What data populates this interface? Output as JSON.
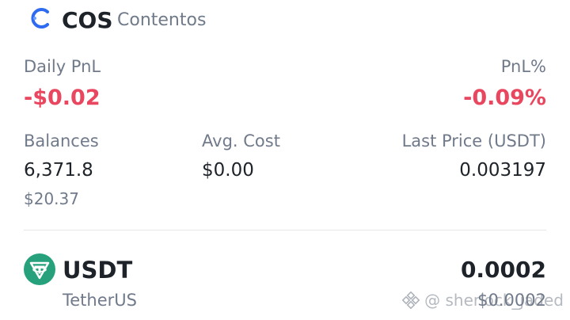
{
  "header": {
    "symbol": "COS",
    "name": "Contentos",
    "icon": "contentos-logo-icon"
  },
  "pnl": {
    "daily_label": "Daily PnL",
    "daily_value": "-$0.02",
    "percent_label": "PnL%",
    "percent_value": "-0.09%"
  },
  "stats": {
    "balances_label": "Balances",
    "balances_value": "6,371.8",
    "balances_usd": "$20.37",
    "avg_cost_label": "Avg. Cost",
    "avg_cost_value": "$0.00",
    "last_price_label": "Last Price (USDT)",
    "last_price_value": "0.003197"
  },
  "asset": {
    "symbol": "USDT",
    "name": "TetherUS",
    "balance": "0.0002",
    "value": "$0.0002",
    "icon": "tether-logo-icon"
  },
  "watermark": {
    "text": "@ sherlock_jaded",
    "icon": "binance-logo-icon"
  },
  "colors": {
    "negative": "#e8475f",
    "text_primary": "#1e2329",
    "text_secondary": "#707a8a",
    "tether_green": "#26a17b",
    "contentos_blue": "#2f6bf0"
  }
}
